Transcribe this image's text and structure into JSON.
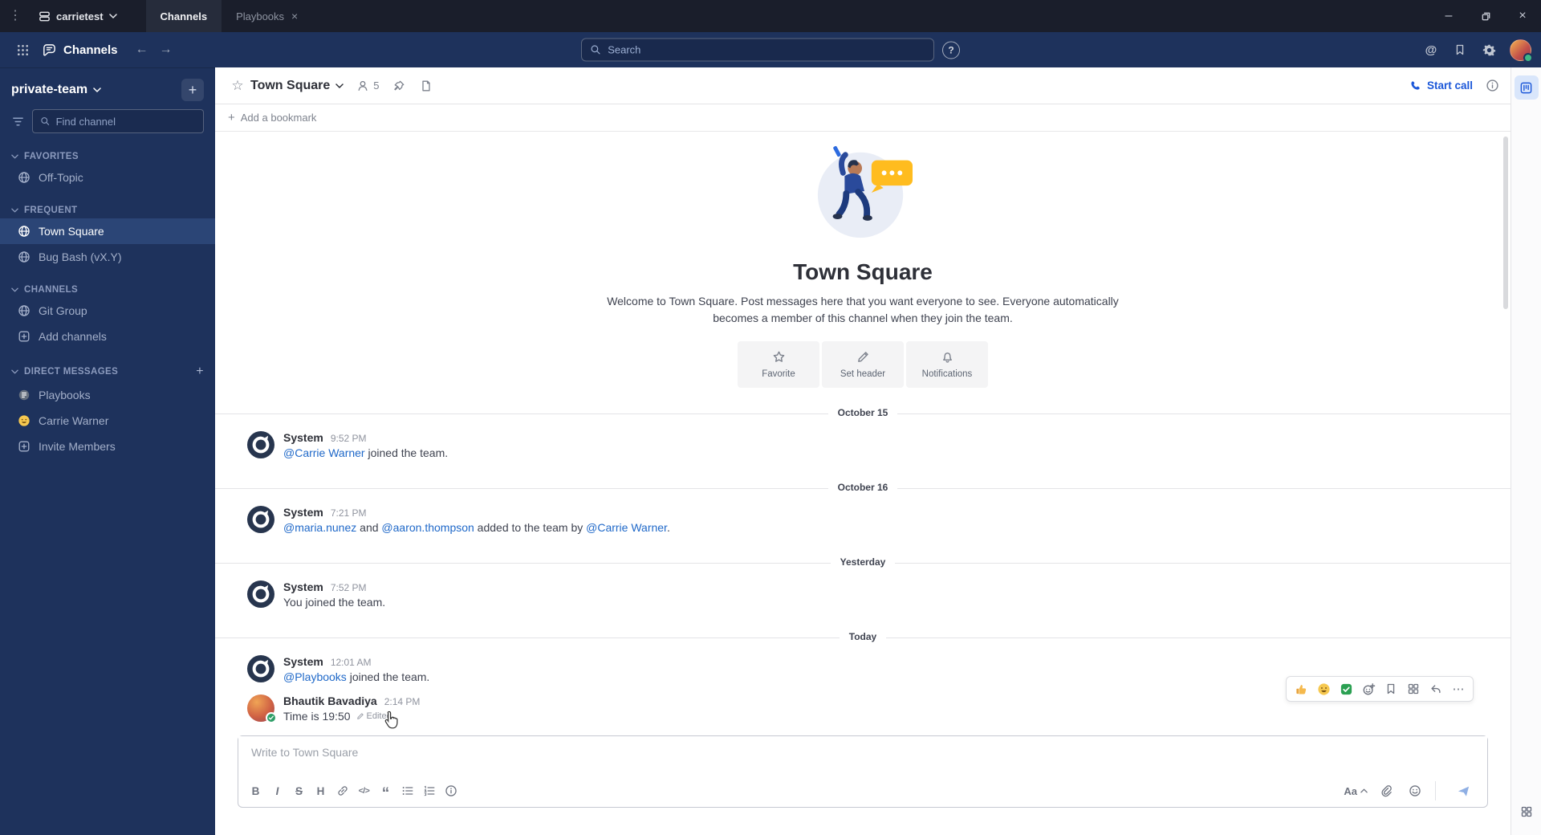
{
  "icons": {
    "app_menu": "⋮",
    "minimize": "–",
    "close": "×",
    "tab_close": "×",
    "back": "←",
    "forward": "→",
    "star": "☆",
    "plus": "+",
    "more": "⋯",
    "at": "@",
    "help": "?",
    "quote": "“",
    "code": "</>"
  },
  "window_bar": {
    "server_name": "carrietest",
    "tabs": [
      {
        "label": "Channels",
        "active": true
      },
      {
        "label": "Playbooks",
        "active": false
      }
    ]
  },
  "global_header": {
    "product": "Channels",
    "search_placeholder": "Search"
  },
  "sidebar": {
    "team_name": "private-team",
    "find_placeholder": "Find channel",
    "sections": [
      {
        "label": "FAVORITES",
        "items": [
          {
            "label": "Off-Topic"
          }
        ]
      },
      {
        "label": "FREQUENT",
        "items": [
          {
            "label": "Town Square",
            "active": true
          },
          {
            "label": "Bug Bash (vX.Y)"
          }
        ]
      },
      {
        "label": "CHANNELS",
        "items": [
          {
            "label": "Git Group"
          },
          {
            "label": "Add channels"
          }
        ]
      },
      {
        "label": "DIRECT MESSAGES",
        "items": [
          {
            "label": "Playbooks"
          },
          {
            "label": "Carrie Warner"
          },
          {
            "label": "Invite Members"
          }
        ]
      }
    ]
  },
  "channel_header": {
    "title": "Town Square",
    "member_count": "5",
    "start_call": "Start call"
  },
  "bookmark_bar": {
    "add_label": "Add a bookmark"
  },
  "intro": {
    "title": "Town Square",
    "description": "Welcome to Town Square. Post messages here that you want everyone to see. Everyone automatically becomes a member of this channel when they join the team.",
    "actions": [
      {
        "label": "Favorite"
      },
      {
        "label": "Set header"
      },
      {
        "label": "Notifications"
      }
    ]
  },
  "feed": [
    {
      "type": "divider",
      "label": "October 15"
    },
    {
      "type": "message",
      "author": "System",
      "time": "9:52 PM",
      "segments": [
        {
          "text": "@Carrie Warner",
          "link": true
        },
        {
          "text": " joined the team.",
          "link": false
        }
      ]
    },
    {
      "type": "divider",
      "label": "October 16"
    },
    {
      "type": "message",
      "author": "System",
      "time": "7:21 PM",
      "segments": [
        {
          "text": "@maria.nunez",
          "link": true
        },
        {
          "text": " and ",
          "link": false
        },
        {
          "text": "@aaron.thompson",
          "link": true
        },
        {
          "text": " added to the team by ",
          "link": false
        },
        {
          "text": "@Carrie Warner",
          "link": true
        },
        {
          "text": ".",
          "link": false
        }
      ]
    },
    {
      "type": "divider",
      "label": "Yesterday"
    },
    {
      "type": "message",
      "author": "System",
      "time": "7:52 PM",
      "segments": [
        {
          "text": "You joined the team.",
          "link": false
        }
      ]
    },
    {
      "type": "divider",
      "label": "Today"
    },
    {
      "type": "message",
      "author": "System",
      "time": "12:01 AM",
      "segments": [
        {
          "text": "@Playbooks",
          "link": true
        },
        {
          "text": " joined the team.",
          "link": false
        }
      ]
    },
    {
      "type": "message",
      "author": "Bhautik Bavadiya",
      "time": "2:14 PM",
      "segments": [
        {
          "text": "Time is 19:50",
          "link": false
        }
      ],
      "edited": "Edited"
    }
  ],
  "message_actions": [
    "thumbs-up",
    "smile",
    "white-check-mark",
    "add-reaction",
    "save-message",
    "message-apps",
    "reply",
    "more-actions"
  ],
  "composer": {
    "placeholder": "Write to Town Square",
    "bold": "B",
    "italic": "I",
    "strike": "S",
    "heading": "H",
    "aa": "Aa"
  },
  "colors": {
    "accent_blue": "#1c58d9",
    "link_blue": "#2069c9",
    "online_green": "#3db887",
    "bubble_yellow": "#ffbc1f",
    "sidebar_bg": "#1e325c",
    "window_bar_bg": "#1a1e2b"
  }
}
